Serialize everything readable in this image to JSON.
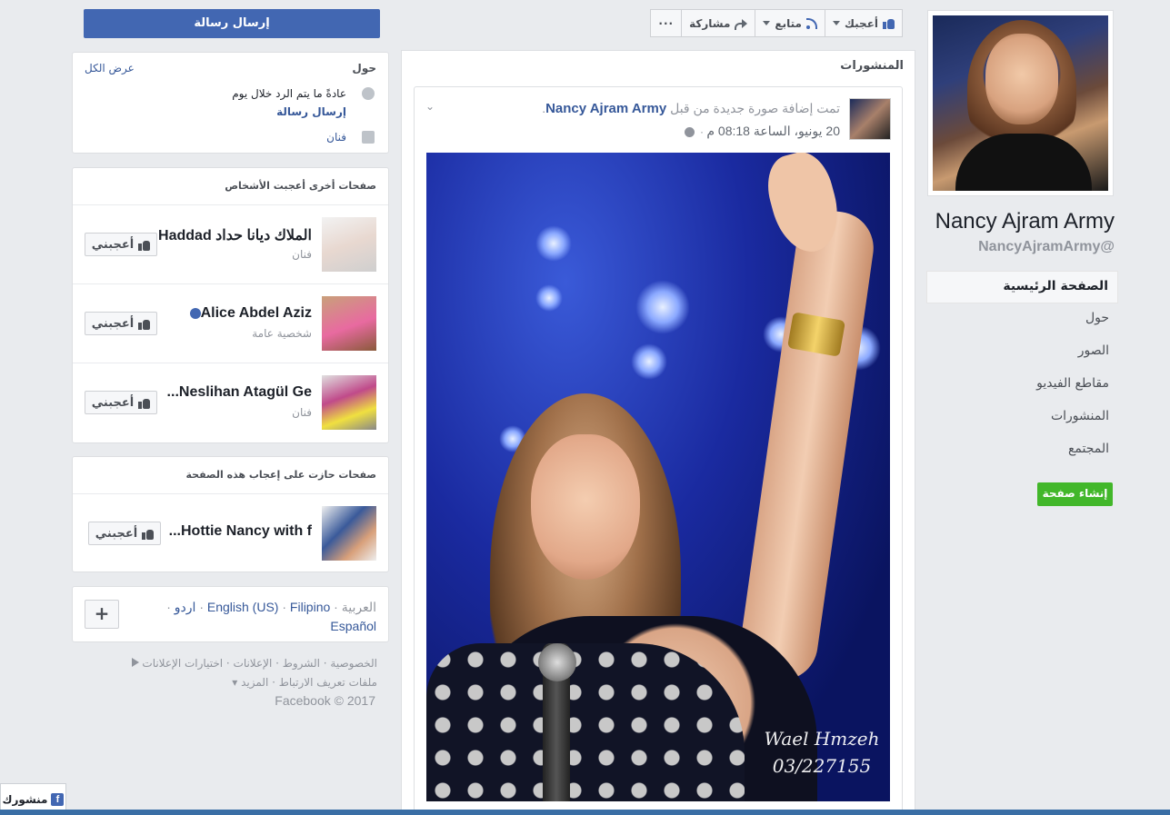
{
  "page": {
    "name": "Nancy Ajram Army",
    "handle": "NancyAjramArmy@"
  },
  "right_nav": {
    "items": [
      {
        "label": "الصفحة الرئيسية",
        "active": true
      },
      {
        "label": "حول"
      },
      {
        "label": "الصور"
      },
      {
        "label": "مقاطع الفيديو"
      },
      {
        "label": "المنشورات"
      },
      {
        "label": "المجتمع"
      }
    ],
    "create_page": "إنشاء صفحة"
  },
  "action_bar": {
    "like": "أعجبك",
    "follow": "متابع",
    "share": "مشاركة",
    "more": "···"
  },
  "send_message": "إرسال رسالة",
  "posts": {
    "heading": "المنشورات",
    "post": {
      "title_prefix": "تمت إضافة صورة جديدة من قبل",
      "author": "Nancy Ajram Army",
      "title_suffix": ".",
      "date": "20 يونيو، الساعة 08:18 م",
      "date_sep": "·",
      "watermark_name": "Wael Hmzeh",
      "watermark_number": "03/227155"
    }
  },
  "about": {
    "title": "حول",
    "see_all": "عرض الكل",
    "response": "عادةً ما يتم الرد خلال يوم",
    "send_message": "إرسال رسالة",
    "category": "فنان"
  },
  "liked_pages": {
    "title": "صفحات أخرى أعجبت الأشخاص",
    "like_label": "أعجبني",
    "items": [
      {
        "name": "الملاك ديانا حداد Haddad...",
        "sub": "فنان"
      },
      {
        "name": "Alice Abdel Aziz",
        "sub": "شخصية عامة",
        "verified": true
      },
      {
        "name": "Neslihan Atagül Ge...",
        "sub": "فنان"
      }
    ]
  },
  "liked_by": {
    "title": "صفحات حازت على إعجاب هذه الصفحة",
    "items": [
      {
        "name": "Hottie Nancy with f..."
      }
    ]
  },
  "languages": {
    "current": "العربية",
    "sep": "·",
    "urdu": "اردو",
    "english": "English (US)",
    "filipino": "Filipino",
    "spanish": "Español",
    "plus": "+"
  },
  "footer": {
    "line1": "الخصوصية · الشروط · الإعلانات · اختيارات الإعلانات",
    "line2": "ملفات تعريف الارتباط · المزيد ▾",
    "copyright": "Facebook © 2017"
  },
  "chat": {
    "label": "منشورك",
    "logo": "f"
  }
}
